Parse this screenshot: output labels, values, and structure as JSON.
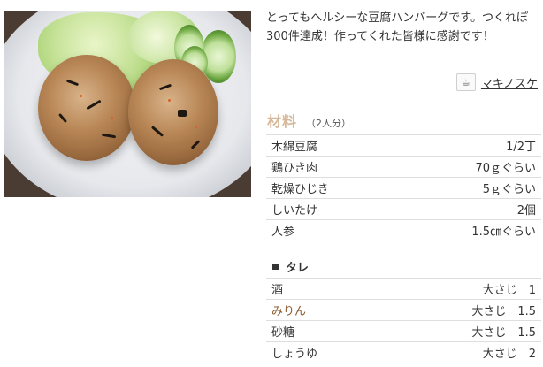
{
  "description": "とってもヘルシーな豆腐ハンバーグです。つくれぽ300件達成！作ってくれた皆様に感謝です！",
  "author": {
    "name": "マキノスケ",
    "icon": "chef-hat-icon"
  },
  "ingredients": {
    "title": "材料",
    "servings": "（2人分）",
    "items": [
      {
        "name": "木綿豆腐",
        "qty": "1/2丁"
      },
      {
        "name": "鶏ひき肉",
        "qty": "70ｇぐらい"
      },
      {
        "name": "乾燥ひじき",
        "qty": "5ｇぐらい"
      },
      {
        "name": "しいたけ",
        "qty": "2個"
      },
      {
        "name": "人参",
        "qty": "1.5㎝ぐらい"
      }
    ],
    "group_title": "タレ",
    "sauce_items": [
      {
        "name": "酒",
        "qty": "大さじ　1"
      },
      {
        "name": "みりん",
        "qty": "大さじ　1.5"
      },
      {
        "name": "砂糖",
        "qty": "大さじ　1.5"
      },
      {
        "name": "しょうゆ",
        "qty": "大さじ　2"
      }
    ]
  },
  "colors": {
    "ingredients_title": "#d7b99a",
    "special_item": "#8a5a2b"
  }
}
